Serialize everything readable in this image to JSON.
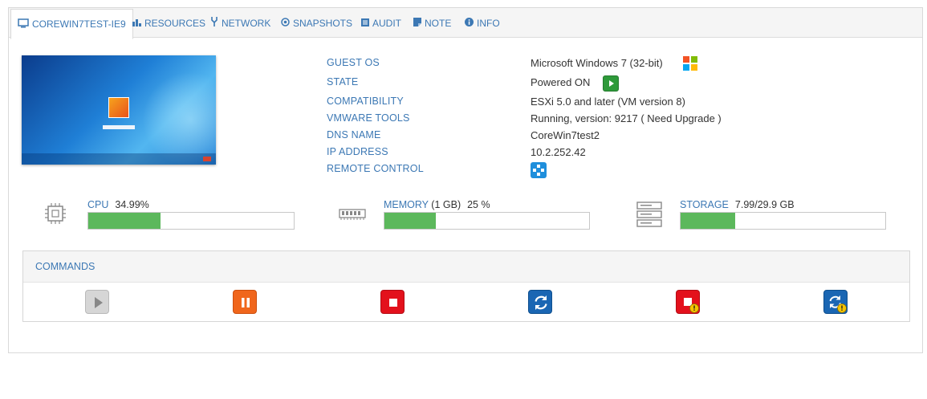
{
  "tabs": [
    {
      "label": "COREWIN7TEST-IE9",
      "icon": "monitor-icon",
      "active": true
    },
    {
      "label": "RESOURCES",
      "icon": "bar-chart-icon"
    },
    {
      "label": "NETWORK",
      "icon": "network-icon"
    },
    {
      "label": "SNAPSHOTS",
      "icon": "snapshot-icon"
    },
    {
      "label": "AUDIT",
      "icon": "audit-icon"
    },
    {
      "label": "NOTE",
      "icon": "note-icon"
    },
    {
      "label": "INFO",
      "icon": "info-icon"
    }
  ],
  "properties": {
    "guest_os": {
      "label": "GUEST OS",
      "value": "Microsoft Windows 7 (32-bit)"
    },
    "state": {
      "label": "STATE",
      "value": "Powered ON"
    },
    "compatibility": {
      "label": "COMPATIBILITY",
      "value": "ESXi 5.0 and later (VM version 8)"
    },
    "vmware_tools": {
      "label": "VMWARE TOOLS",
      "value": "Running, version: 9217 ( Need Upgrade )"
    },
    "dns_name": {
      "label": "DNS NAME",
      "value": "CoreWin7test2"
    },
    "ip_address": {
      "label": "IP ADDRESS",
      "value": "10.2.252.42"
    },
    "remote_control": {
      "label": "REMOTE CONTROL"
    }
  },
  "meters": {
    "cpu": {
      "label": "CPU",
      "value": "34.99%",
      "fraction": 0.3499
    },
    "memory": {
      "label": "MEMORY",
      "sub": "(1 GB)",
      "value": "25 %",
      "fraction": 0.25
    },
    "storage": {
      "label": "STORAGE",
      "value": "7.99/29.9 GB",
      "fraction": 0.267
    }
  },
  "commands": {
    "title": "COMMANDS",
    "items": [
      {
        "name": "power-on",
        "state": "disabled"
      },
      {
        "name": "suspend",
        "state": "enabled"
      },
      {
        "name": "power-off",
        "state": "enabled"
      },
      {
        "name": "reset",
        "state": "enabled"
      },
      {
        "name": "shutdown-guest",
        "state": "enabled"
      },
      {
        "name": "restart-guest",
        "state": "enabled"
      }
    ]
  },
  "colors": {
    "accent": "#3c78b4",
    "meter_fill": "#5cb85c",
    "power_on_green": "#2e9a3a",
    "suspend_orange": "#f0661c",
    "stop_red": "#e3111c",
    "reset_blue": "#1a66b3",
    "warning_yellow": "#f5c400"
  }
}
